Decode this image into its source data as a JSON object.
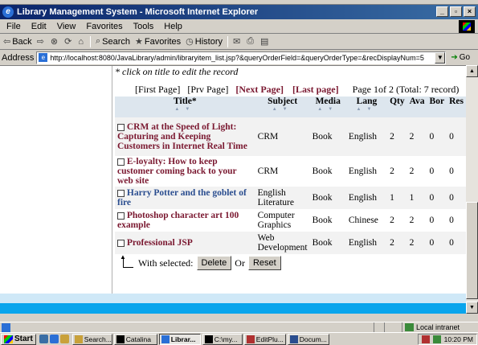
{
  "window": {
    "title": "Library Management System - Microsoft Internet Explorer"
  },
  "menu": [
    "File",
    "Edit",
    "View",
    "Favorites",
    "Tools",
    "Help"
  ],
  "toolbar": {
    "back": "Back",
    "search": "Search",
    "favorites": "Favorites",
    "history": "History"
  },
  "address": {
    "label": "Address",
    "url": "http://localhost:8080/JavaLibrary/admin/libraryitem_list.jsp?&queryOrderField=&queryOrderType=&recDisplayNum=5",
    "go": "Go"
  },
  "page": {
    "hint": "* click on title to edit the record",
    "nav": {
      "first": "[First Page]",
      "prev": "[Prv Page]",
      "next": "[Next Page]",
      "last": "[Last page]",
      "info": "Page 1of 2 (Total: 7 record)"
    },
    "columns": {
      "title": "Title",
      "title_sort_mark": "*",
      "subject": "Subject",
      "media": "Media",
      "lang": "Lang",
      "qty": "Qty",
      "ava": "Ava",
      "bor": "Bor",
      "res": "Res"
    },
    "rows": [
      {
        "title": "CRM at the Speed of Light: Capturing and Keeping Customers in Internet Real Time",
        "subject": "CRM",
        "media": "Book",
        "lang": "English",
        "qty": "2",
        "ava": "2",
        "bor": "0",
        "res": "0"
      },
      {
        "title": "E-loyalty: How to keep customer coming back to your web site",
        "subject": "CRM",
        "media": "Book",
        "lang": "English",
        "qty": "2",
        "ava": "2",
        "bor": "0",
        "res": "0"
      },
      {
        "title": "Harry Potter and the goblet of fire",
        "subject": "English Literature",
        "media": "Book",
        "lang": "English",
        "qty": "1",
        "ava": "1",
        "bor": "0",
        "res": "0"
      },
      {
        "title": "Photoshop character art 100 example",
        "subject": "Computer Graphics",
        "media": "Book",
        "lang": "Chinese",
        "qty": "2",
        "ava": "2",
        "bor": "0",
        "res": "0"
      },
      {
        "title": "Professional JSP",
        "subject": "Web Development",
        "media": "Book",
        "lang": "English",
        "qty": "2",
        "ava": "2",
        "bor": "0",
        "res": "0"
      }
    ],
    "with_selected": "With selected:",
    "delete": "Delete",
    "or": "Or",
    "reset": "Reset"
  },
  "status": {
    "zone": "Local intranet"
  },
  "taskbar": {
    "start": "Start",
    "tasks": [
      "Search...",
      "Catalina",
      "Librar...",
      "C:\\my...",
      "EditPlu...",
      "Docum..."
    ],
    "clock": "10:20 PM"
  }
}
